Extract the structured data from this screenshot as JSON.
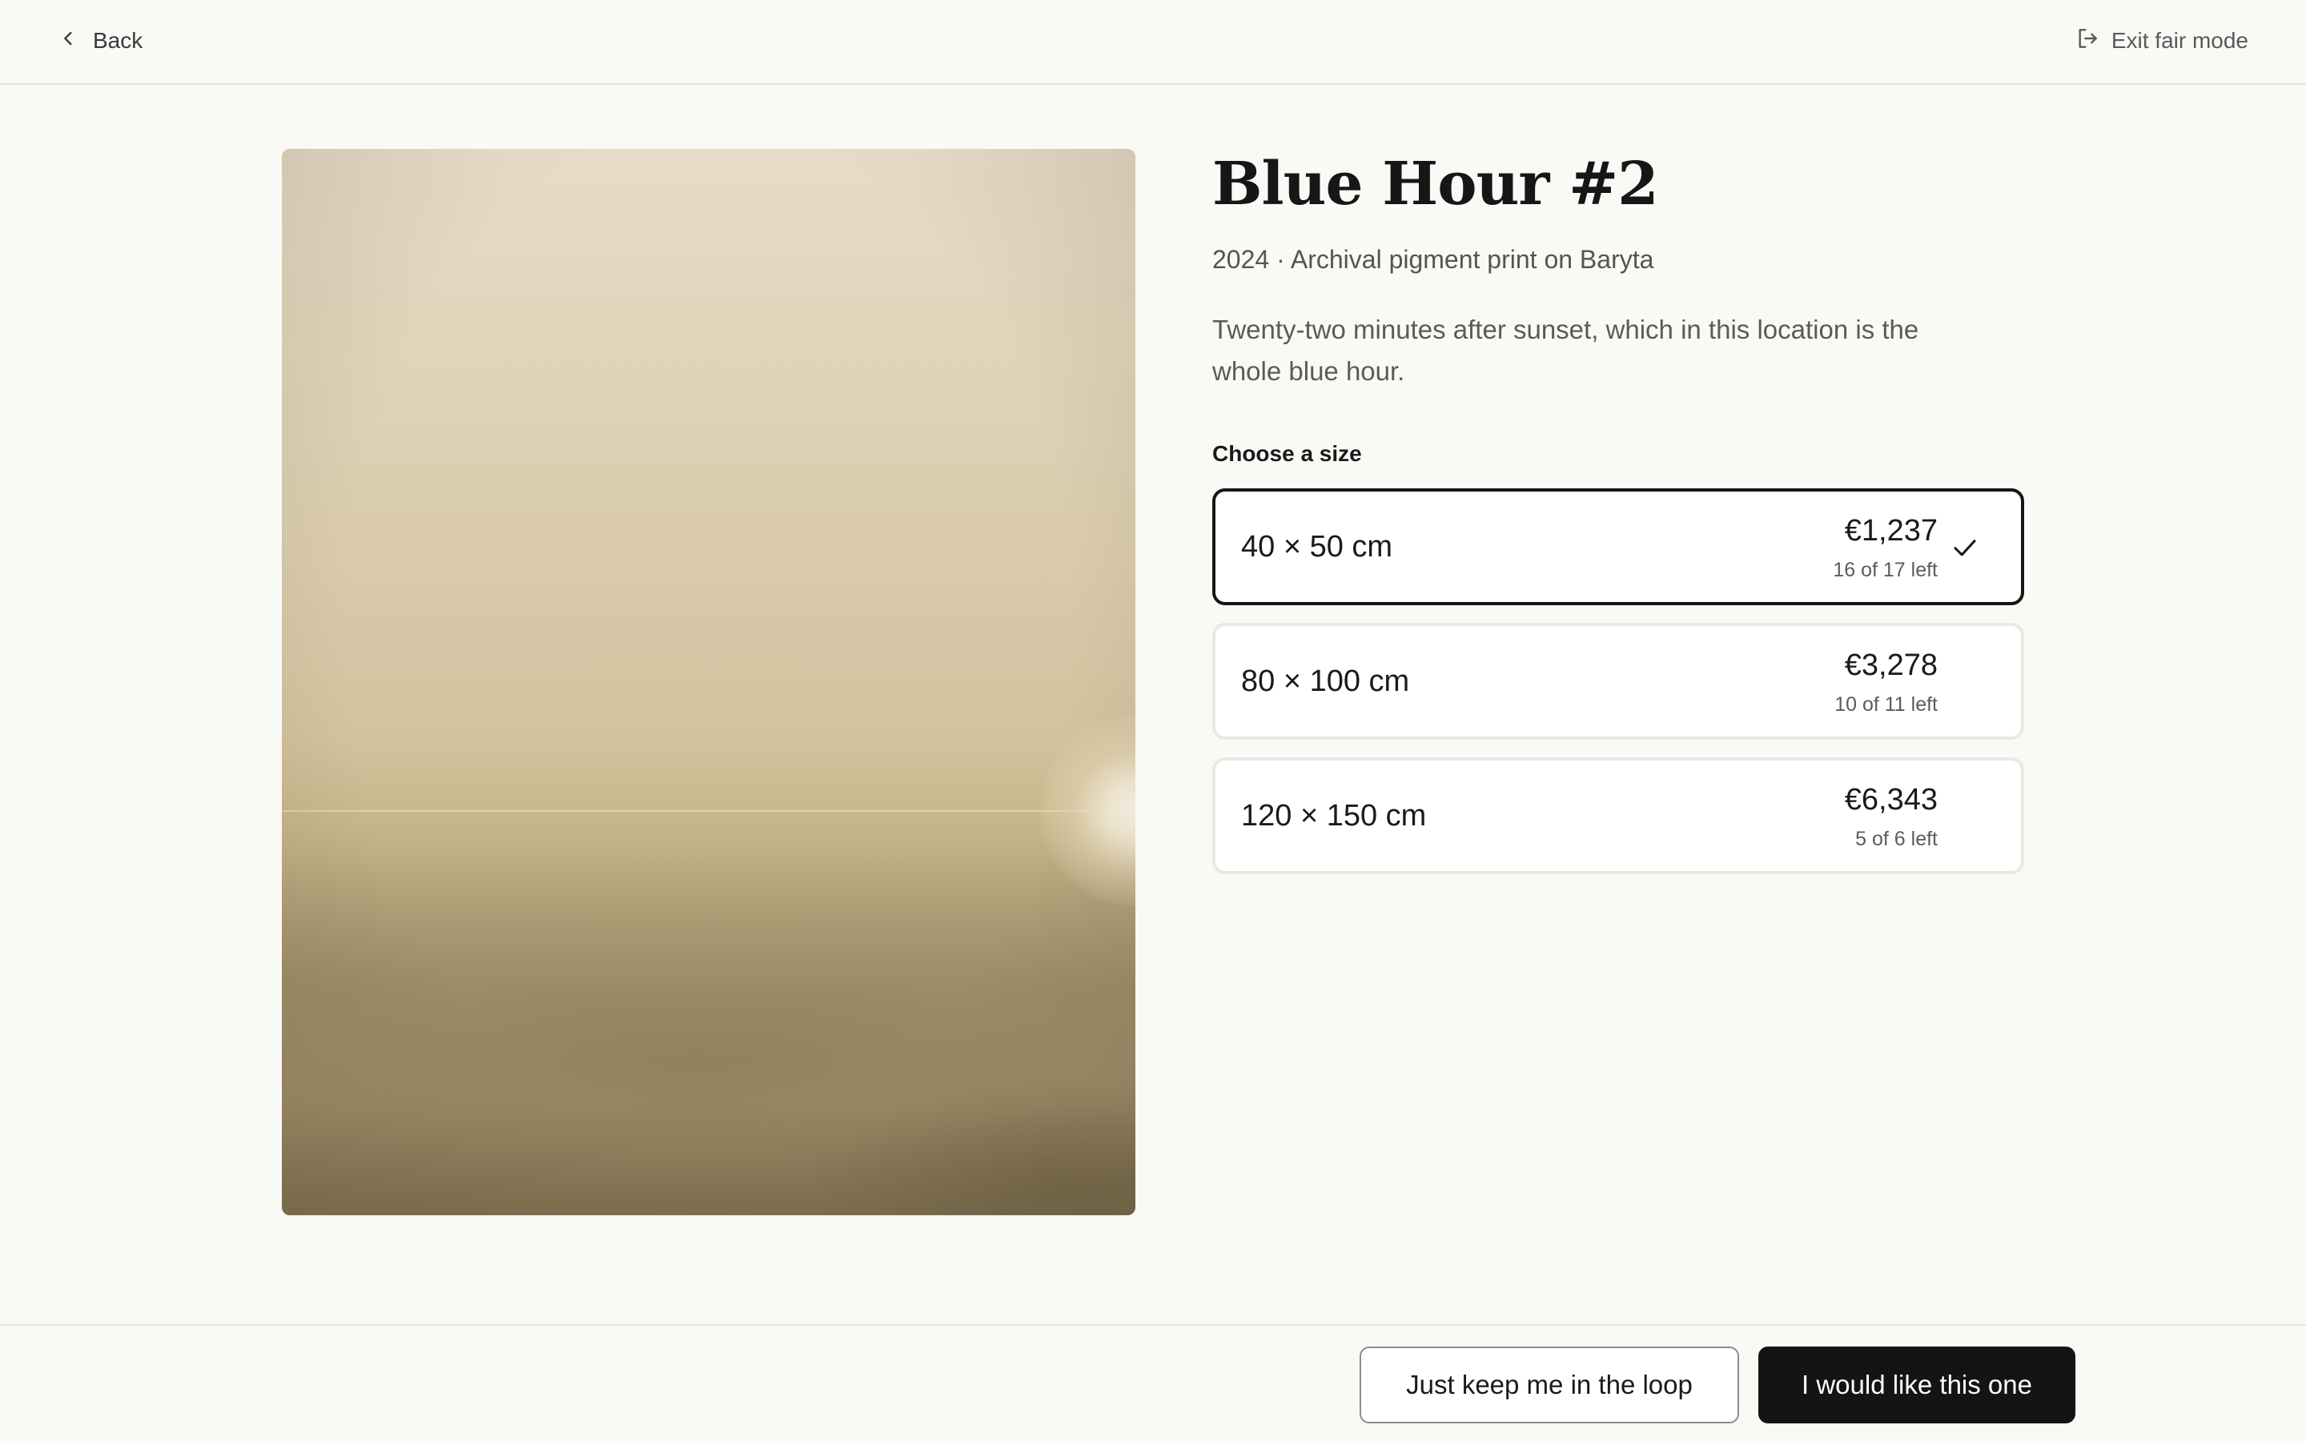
{
  "topbar": {
    "back_label": "Back",
    "exit_label": "Exit fair mode"
  },
  "artwork": {
    "title": "Blue Hour #2",
    "meta": "2024 · Archival pigment print on Baryta",
    "description": "Twenty-two minutes after sunset, which in this location is the whole blue hour."
  },
  "size_picker": {
    "label": "Choose a size",
    "options": [
      {
        "dims": "40 × 50 cm",
        "price": "€1,237",
        "stock": "16 of 17 left",
        "selected": true
      },
      {
        "dims": "80 × 100 cm",
        "price": "€3,278",
        "stock": "10 of 11 left",
        "selected": false
      },
      {
        "dims": "120 × 150 cm",
        "price": "€6,343",
        "stock": "5 of 6 left",
        "selected": false
      }
    ]
  },
  "actions": {
    "secondary_label": "Just keep me in the loop",
    "primary_label": "I would like this one"
  },
  "colors": {
    "background": "#f9f9f6",
    "primary_button": "#141414",
    "selected_border": "#151515"
  }
}
